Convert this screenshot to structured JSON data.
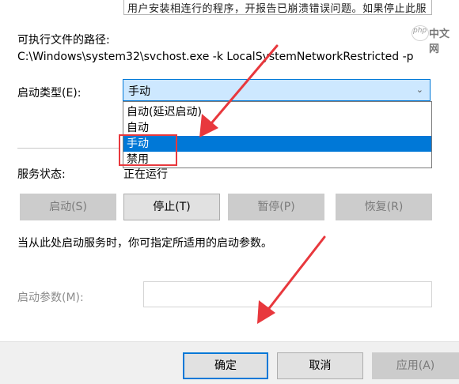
{
  "description": {
    "text": "用户安装相连行的程序，开报告已崩溃错误问题。如果停止此服务，PCA 将无法正常运行"
  },
  "watermark": {
    "letters": "php",
    "text": "中文网"
  },
  "path": {
    "label": "可执行文件的路径:",
    "value": "C:\\Windows\\system32\\svchost.exe -k LocalSystemNetworkRestricted -p"
  },
  "startup_type": {
    "label": "启动类型(E):",
    "selected": "手动",
    "options": [
      "自动(延迟启动)",
      "自动",
      "手动",
      "禁用"
    ],
    "highlighted_index": 2
  },
  "service_status": {
    "label": "服务状态:",
    "value": "正在运行"
  },
  "control_buttons": {
    "start": "启动(S)",
    "stop": "停止(T)",
    "pause": "暂停(P)",
    "resume": "恢复(R)"
  },
  "hint": "当从此处启动服务时，你可指定所适用的启动参数。",
  "start_params": {
    "label": "启动参数(M):",
    "value": ""
  },
  "dialog_buttons": {
    "ok": "确定",
    "cancel": "取消",
    "apply": "应用(A)"
  },
  "colors": {
    "accent": "#0078d7",
    "annotation_red": "#e8383d",
    "combo_bg": "#cde8ff",
    "disabled_bg": "#cccccc"
  }
}
